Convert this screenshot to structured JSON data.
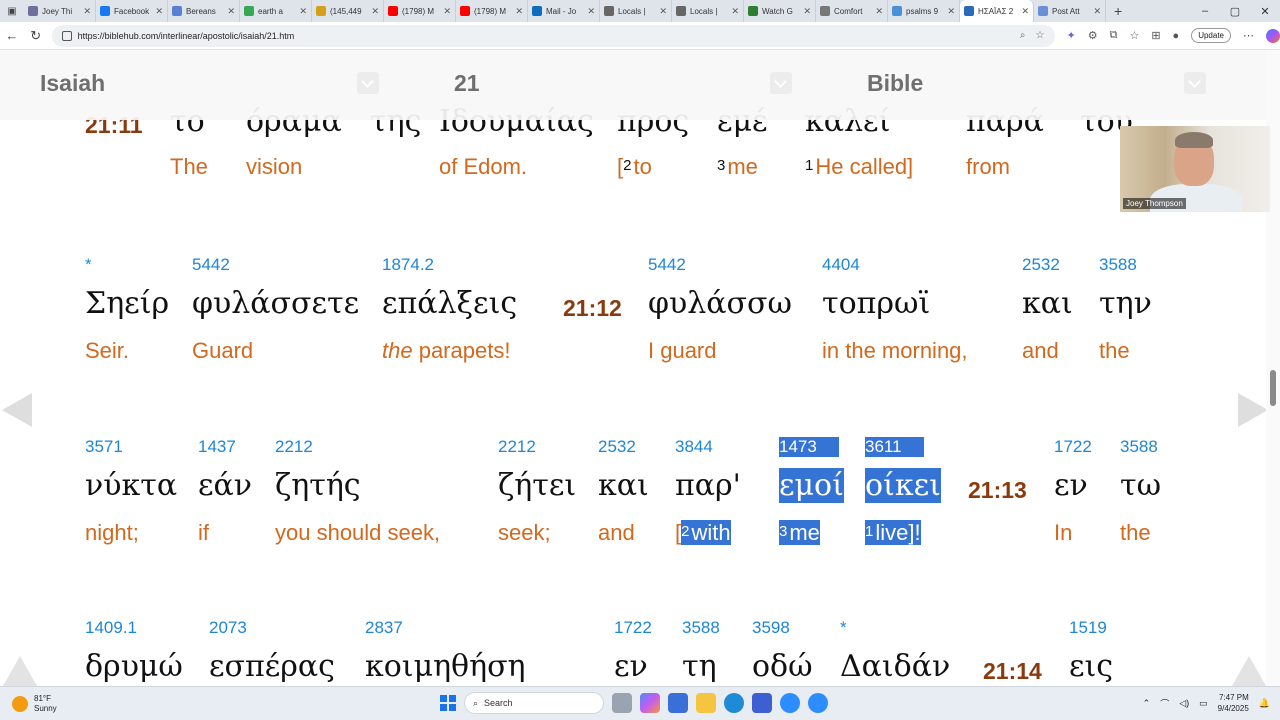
{
  "browser": {
    "tabs": [
      {
        "label": "Joey Thi",
        "color": "#6f6f9f"
      },
      {
        "label": "Facebook",
        "color": "#1877f2"
      },
      {
        "label": "Bereans",
        "color": "#5a7fd6"
      },
      {
        "label": "earth a",
        "color": "#34a853"
      },
      {
        "label": "(145,449",
        "color": "#d4a017"
      },
      {
        "label": "(1798) M",
        "color": "#ff0000"
      },
      {
        "label": "(1798) M",
        "color": "#ff0000"
      },
      {
        "label": "Mail - Jo",
        "color": "#0f6cbd"
      },
      {
        "label": "Locals |",
        "color": "#666666"
      },
      {
        "label": "Locals |",
        "color": "#666666"
      },
      {
        "label": "Watch G",
        "color": "#2e7d32"
      },
      {
        "label": "Comfort",
        "color": "#777777"
      },
      {
        "label": "psalms 9",
        "color": "#4a90d9"
      },
      {
        "label": "ΗΣΑΪΑΣ 2",
        "color": "#2a6ab8",
        "active": true
      },
      {
        "label": "Post Att",
        "color": "#6a8fd6"
      }
    ],
    "new_tab": "+",
    "url": "https://biblehub.com/interlinear/apostolic/isaiah/21.htm",
    "update_label": "Update"
  },
  "header": {
    "book": "Isaiah",
    "chapter": "21",
    "version": "Bible"
  },
  "rows": [
    {
      "words": [
        {
          "ref": "21:11"
        },
        {
          "gk": "το",
          "en": "The"
        },
        {
          "gk": "όραμα",
          "en": "vision"
        },
        {
          "gk": "της"
        },
        {
          "gk": "Ιδουμαίας",
          "en": "of Edom."
        },
        {
          "gk": "προς",
          "en_prefix": "[",
          "sup": "2",
          "en": "to"
        },
        {
          "gk": "εμέ",
          "sup": "3",
          "en": "me"
        },
        {
          "gk": "καλεί",
          "sup": "1",
          "en": "He called]"
        },
        {
          "gk": "παρά",
          "en": "from"
        },
        {
          "gk": "του"
        }
      ]
    },
    {
      "words": [
        {
          "num": "*",
          "gk": "Σηείρ",
          "en": "Seir."
        },
        {
          "num": "5442",
          "gk": "φυλάσσετε",
          "en": "Guard"
        },
        {
          "num": "1874.2",
          "gk": "επάλξεις",
          "en_italic": "the",
          "en": "parapets!"
        },
        {
          "ref": "21:12"
        },
        {
          "num": "5442",
          "gk": "φυλάσσω",
          "en": "I guard"
        },
        {
          "num": "4404",
          "gk": "τοπρωϊ",
          "en": "in the morning,"
        },
        {
          "num": "2532",
          "gk": "και",
          "en": "and"
        },
        {
          "num": "3588",
          "gk": "την",
          "en": "the"
        }
      ]
    },
    {
      "words": [
        {
          "num": "3571",
          "gk": "νύκτα",
          "en": "night;"
        },
        {
          "num": "1437",
          "gk": "εάν",
          "en": "if"
        },
        {
          "num": "2212",
          "gk": "ζητής",
          "en": "you should seek,"
        },
        {
          "num": "2212",
          "gk": "ζήτει",
          "en": "seek;"
        },
        {
          "num": "2532",
          "gk": "και",
          "en": "and"
        },
        {
          "num": "3844",
          "gk": "παρ'",
          "en_prefix": "[",
          "sup": "2",
          "en": "with"
        },
        {
          "num": "1473",
          "gk": "εμοί",
          "sup": "3",
          "en": "me"
        },
        {
          "num": "3611",
          "gk": "οίκει",
          "sup": "1",
          "en": "live]!"
        },
        {
          "ref": "21:13"
        },
        {
          "num": "1722",
          "gk": "εν",
          "en": "In"
        },
        {
          "num": "3588",
          "gk": "τω",
          "en": "the"
        }
      ]
    },
    {
      "words": [
        {
          "num": "1409.1",
          "gk": "δρυμώ"
        },
        {
          "num": "2073",
          "gk": "εσπέρας"
        },
        {
          "num": "2837",
          "gk": "κοιμηθήση"
        },
        {
          "num": "1722",
          "gk": "εν"
        },
        {
          "num": "3588",
          "gk": "τη"
        },
        {
          "num": "3598",
          "gk": "οδώ"
        },
        {
          "num": "*",
          "gk": "Δαιδάν"
        },
        {
          "ref": "21:14"
        },
        {
          "num": "1519",
          "gk": "εις"
        }
      ]
    }
  ],
  "video": {
    "name": "Joey Thompson"
  },
  "taskbar": {
    "temp": "81°F",
    "condition": "Sunny",
    "search_placeholder": "Search",
    "time": "7:47 PM",
    "date": "9/4/2025"
  }
}
